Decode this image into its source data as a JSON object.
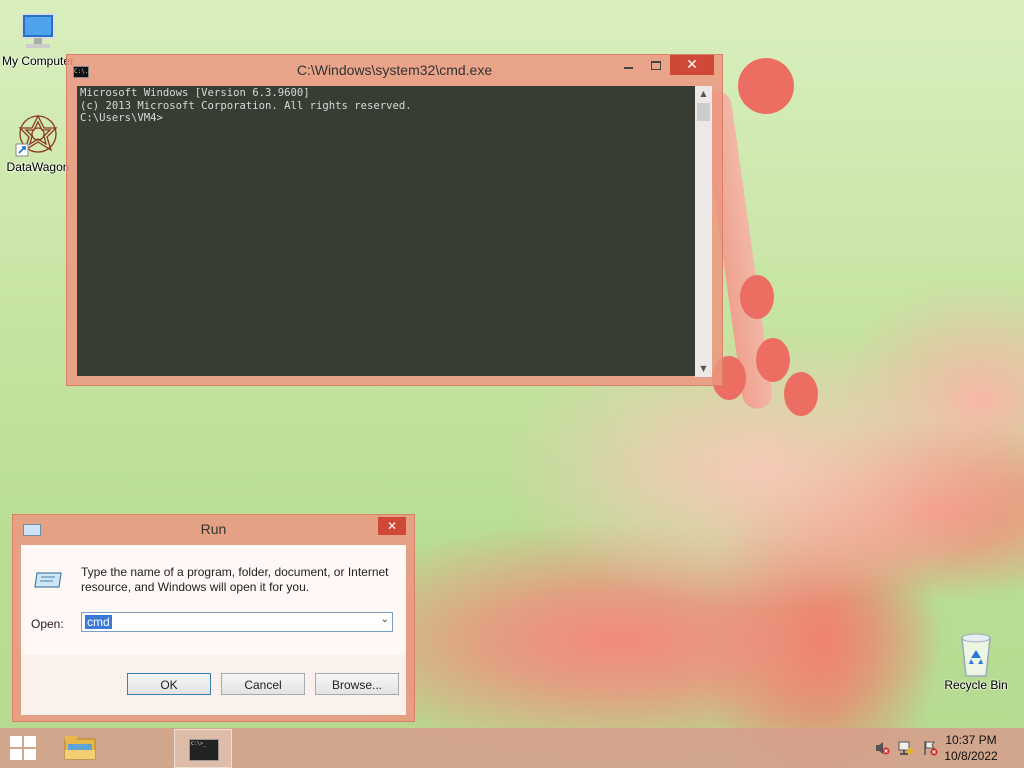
{
  "desktop": {
    "icons": [
      {
        "label": "My Computer"
      },
      {
        "label": "DataWagon"
      },
      {
        "label": "Recycle Bin"
      }
    ]
  },
  "cmd_window": {
    "title": "C:\\Windows\\system32\\cmd.exe",
    "app_icon_text": "C:\\.",
    "lines": [
      "Microsoft Windows [Version 6.3.9600]",
      "(c) 2013 Microsoft Corporation. All rights reserved.",
      "",
      "C:\\Users\\VM4>"
    ],
    "close_glyph": "✕"
  },
  "run_dialog": {
    "title": "Run",
    "description": "Type the name of a program, folder, document, or Internet resource, and Windows will open it for you.",
    "open_label": "Open:",
    "open_value": "cmd",
    "ok_label": "OK",
    "cancel_label": "Cancel",
    "browse_label": "Browse...",
    "close_glyph": "✕"
  },
  "taskbar": {
    "cmd_thumb_text": "C:\\>_",
    "clock_time": "10:37 PM",
    "clock_date": "10/8/2022"
  }
}
